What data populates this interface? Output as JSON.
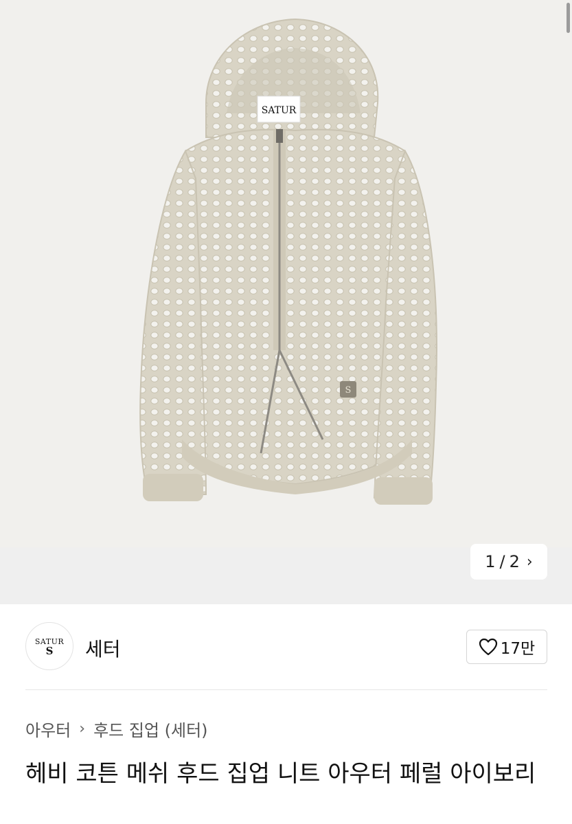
{
  "gallery": {
    "brand_label": "SATUR",
    "pager_current": "1",
    "pager_separator": "/",
    "pager_total": "2",
    "pager_next_icon": "chevron-right-icon"
  },
  "seller": {
    "avatar_text": "SATUR",
    "avatar_mark": "S",
    "name": "세터",
    "like_icon": "heart-outline-icon",
    "like_count": "17만"
  },
  "breadcrumb": {
    "items": [
      "아우터",
      "후드 집업 (세터)"
    ],
    "separator_icon": "chevron-right-icon"
  },
  "product": {
    "title": "헤비 코튼 메쉬 후드 집업 니트 아우터 페럴 아이보리"
  },
  "colors": {
    "knit": "#d8d3c4",
    "knit_hole": "#f1f0ed",
    "gallery_bg": "#efefef"
  }
}
